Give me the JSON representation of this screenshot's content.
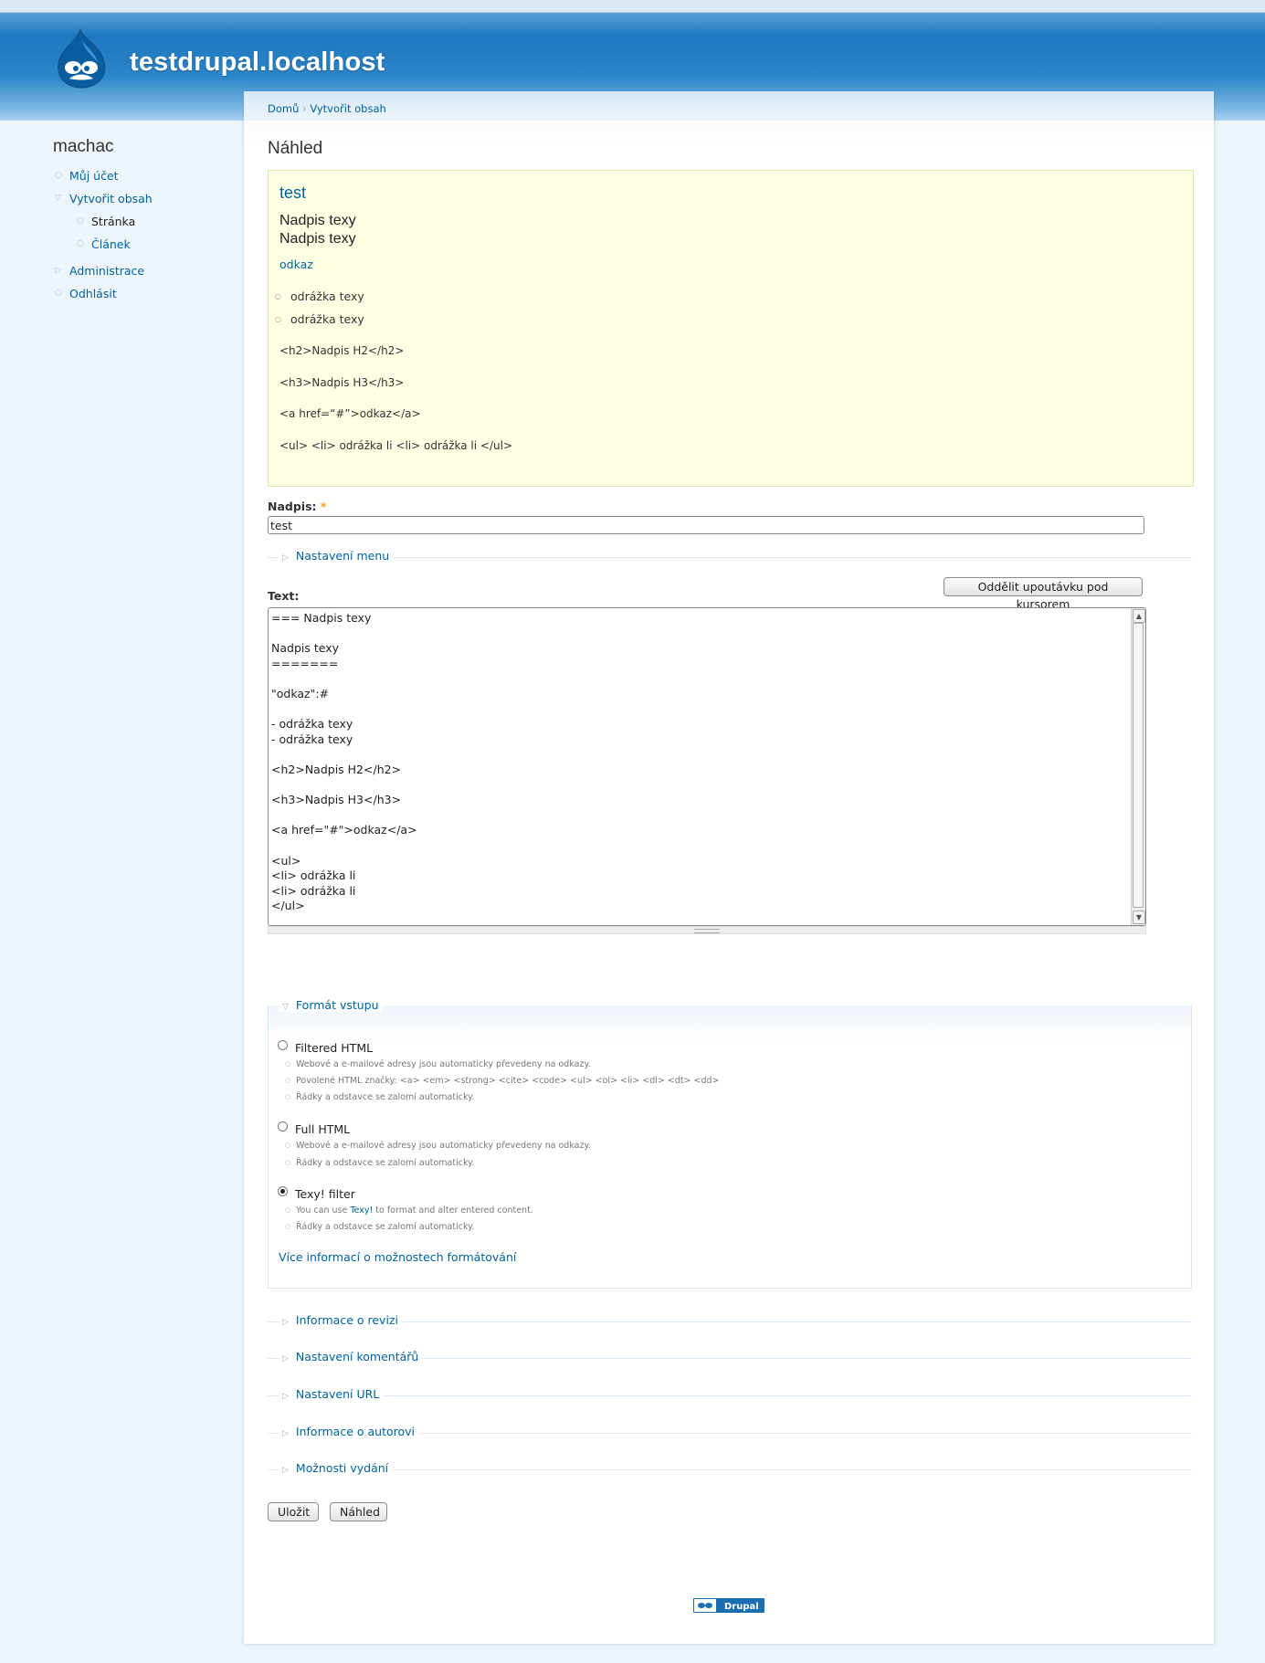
{
  "header": {
    "site_name": "testdrupal.localhost"
  },
  "sidebar": {
    "title": "machac",
    "items": [
      {
        "label": "Můj účet"
      },
      {
        "label": "Vytvořit obsah"
      },
      {
        "label": "Stránka"
      },
      {
        "label": "Článek"
      },
      {
        "label": "Administrace"
      },
      {
        "label": "Odhlásit"
      }
    ]
  },
  "breadcrumb": {
    "home": "Domů",
    "separator": "›",
    "current": "Vytvořit obsah"
  },
  "page_title": "Náhled",
  "preview": {
    "title": "test",
    "heading1": "Nadpis texy",
    "heading2": "Nadpis texy",
    "link": "odkaz",
    "bullets": [
      "odrážka texy",
      "odrážka texy"
    ],
    "code_lines": [
      "<h2>Nadpis H2</h2>",
      "<h3>Nadpis H3</h3>",
      "<a href=“#”>odkaz</a>",
      "<ul> <li> odrážka li <li> odrážka li </ul>"
    ]
  },
  "form": {
    "title_label": "Nadpis:",
    "required_mark": "*",
    "title_value": "test",
    "menu_settings": "Nastavení menu",
    "text_label": "Text:",
    "split_button": "Oddělit upoutávku pod kursorem",
    "text_value": "=== Nadpis texy\n\nNadpis texy\n=======\n\n\"odkaz\":#\n\n- odrážka texy\n- odrážka texy\n\n<h2>Nadpis H2</h2>\n\n<h3>Nadpis H3</h3>\n\n<a href=\"#\">odkaz</a>\n\n<ul>\n<li> odrážka li\n<li> odrážka li\n</ul>",
    "format": {
      "legend": "Formát vstupu",
      "options": [
        {
          "label": "Filtered HTML",
          "tips": [
            "Webové a e-mailové adresy jsou automaticky převedeny na odkazy.",
            "Povolené HTML značky: <a> <em> <strong> <cite> <code> <ul> <ol> <li> <dl> <dt> <dd>",
            "Řádky a odstavce se zalomí automaticky."
          ]
        },
        {
          "label": "Full HTML",
          "tips": [
            "Webové a e-mailové adresy jsou automaticky převedeny na odkazy.",
            "Řádky a odstavce se zalomí automaticky."
          ]
        },
        {
          "label": "Texy! filter",
          "tip_prefix": "You can use ",
          "tip_link": "Texy!",
          "tip_suffix": " to format and alter entered content.",
          "tips": [
            "Řádky a odstavce se zalomí automaticky."
          ]
        }
      ],
      "selected": "Texy! filter",
      "more_info": "Více informací o možnostech formátování"
    },
    "fieldsets": [
      "Informace o revizi",
      "Nastavení komentářů",
      "Nastavení URL",
      "Informace o autorovi",
      "Možnosti vydání"
    ],
    "save_button": "Uložit",
    "preview_button": "Náhled"
  },
  "footer": {
    "badge": "Drupal"
  }
}
